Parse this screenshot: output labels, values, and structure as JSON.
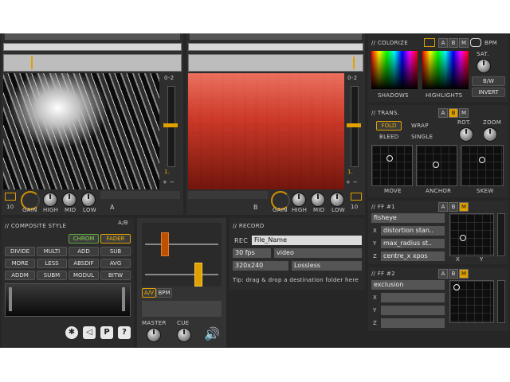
{
  "deck_left": {
    "slider_label": "0-2",
    "value_label": "1.",
    "plus_minus": "+ −",
    "num": "10",
    "knobs": [
      "GAIN",
      "HIGH",
      "MID",
      "LOW"
    ],
    "deck_letter": "A"
  },
  "deck_right": {
    "slider_label": "0-2",
    "value_label": "1.",
    "plus_minus": "+ −",
    "num": "10",
    "knobs": [
      "GAIN",
      "HIGH",
      "MID",
      "LOW"
    ],
    "deck_letter": "B"
  },
  "colorize": {
    "title": "// COLORIZE",
    "tabs": [
      "A",
      "B",
      "M"
    ],
    "shadows": "SHADOWS",
    "highlights": "HIGHLIGHTS",
    "sat": "SAT.",
    "bw": "B/W",
    "invert": "INVERT",
    "bpm": "BPM"
  },
  "trans": {
    "title": "// TRANS.",
    "tabs": [
      "A",
      "B",
      "M"
    ],
    "fold": "FOLD",
    "wrap": "WRAP",
    "bleed": "BLEED",
    "single": "SINGLE",
    "rot": "ROT.",
    "zoom": "ZOOM",
    "grids": [
      "MOVE",
      "ANCHOR",
      "SKEW"
    ]
  },
  "ff1": {
    "title": "// FF #1",
    "tabs": [
      "A",
      "B",
      "M"
    ],
    "effect": "fisheye",
    "rows": [
      {
        "key": "X",
        "value": "distortion stan.."
      },
      {
        "key": "Y",
        "value": "max_radius st.."
      },
      {
        "key": "Z",
        "value": "centre_x xpos"
      }
    ],
    "axes": [
      "X",
      "Y"
    ]
  },
  "ff2": {
    "title": "// FF #2",
    "tabs": [
      "A",
      "B",
      "M"
    ],
    "effect": "exclusion",
    "rows": [
      {
        "key": "X",
        "value": ""
      },
      {
        "key": "Y",
        "value": ""
      },
      {
        "key": "Z",
        "value": ""
      }
    ],
    "axes": [
      "X",
      "Y"
    ]
  },
  "composite": {
    "title": "// COMPOSITE STYLE",
    "ab": "A/B",
    "chrom": "CHROM",
    "fader": "FADER",
    "modes": [
      "DIVIDE",
      "MULTI",
      "ADD",
      "SUB",
      "MORE",
      "LESS",
      "ABSDIF",
      "AVG",
      "ADDM",
      "SUBM",
      "MODUL",
      "BITW"
    ]
  },
  "mixer": {
    "av": "A/V",
    "bpm": "BPM",
    "master": "MASTER",
    "cue": "CUE"
  },
  "record": {
    "title": "// RECORD",
    "rec": "REC",
    "filename": "File_Name",
    "fps": "30 fps",
    "format": "video",
    "size": "320x240",
    "codec": "Lossless",
    "tip": "Tip: drag & drop a destination folder here"
  },
  "bottom_icons": [
    "midi-icon",
    "speaker-icon",
    "p-icon",
    "help-icon"
  ],
  "bottom_icon_text": {
    "p": "P",
    "q": "?"
  },
  "colors": {
    "accent": "#e0a000",
    "green": "#7fdc4a",
    "panel": "#2b2b2b"
  }
}
